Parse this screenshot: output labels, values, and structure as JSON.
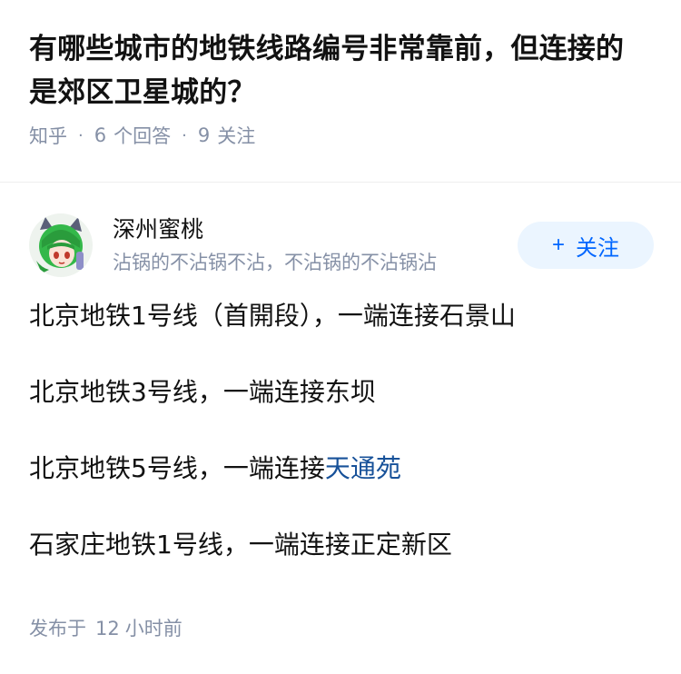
{
  "question": {
    "title": "有哪些城市的地铁线路编号非常靠前，但连接的是郊区卫星城的？",
    "source": "知乎",
    "answer_count": "6",
    "answer_label": "个回答",
    "follow_count": "9",
    "follow_label": "关注"
  },
  "answer": {
    "author_name": "深州蜜桃",
    "author_bio": "沾锅的不沾锅不沾，不沾锅的不沾锅沾",
    "follow_button_plus": "+",
    "follow_button_label": "关注",
    "paragraphs": [
      "北京地铁1号线（首開段），一端连接石景山",
      "北京地铁3号线，一端连接东坝",
      "北京地铁5号线，一端连接",
      "石家庄地铁1号线，一端连接正定新区"
    ],
    "link_text": "天通苑",
    "posted_prefix": "发布于",
    "posted_num": "12",
    "posted_unit": "小时前"
  },
  "colors": {
    "link": "#175199",
    "meta": "#8590a6",
    "accent": "#0066ff",
    "follow_bg": "#ebf5ff"
  }
}
